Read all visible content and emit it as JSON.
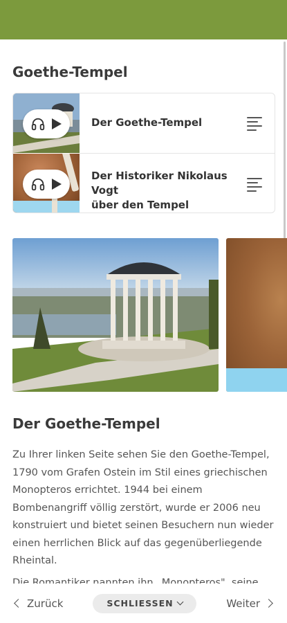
{
  "header": {
    "color": "#7c9a3d"
  },
  "page": {
    "title": "Goethe-Tempel"
  },
  "audio_tracks": [
    {
      "label": "Der Goethe-Tempel",
      "play_icon": "play-icon",
      "audio_icon": "headphones-icon",
      "menu_icon": "list-icon"
    },
    {
      "label_line1": "Der Historiker Nikolaus Vogt",
      "label_line2": "über den Tempel",
      "play_icon": "play-icon",
      "audio_icon": "headphones-icon",
      "menu_icon": "list-icon"
    }
  ],
  "article": {
    "title": "Der Goethe-Tempel",
    "paragraph1": "Zu Ihrer linken Seite sehen Sie den Goethe-Tempel, 1790 vom Grafen Ostein im Stil eines griechischen Monopteros errichtet. 1944 bei einem Bombenangriff völlig zerstört, wurde er 2006 neu konstruiert und bietet seinen Besuchern nun wieder einen herrlichen Blick auf das gegenüberliegende Rheintal.",
    "paragraph2": "Die Romantiker nannten ihn „Monopteros\", seine"
  },
  "bottom_nav": {
    "back_label": "Zurück",
    "close_label": "SCHLIESSEN",
    "next_label": "Weiter"
  }
}
